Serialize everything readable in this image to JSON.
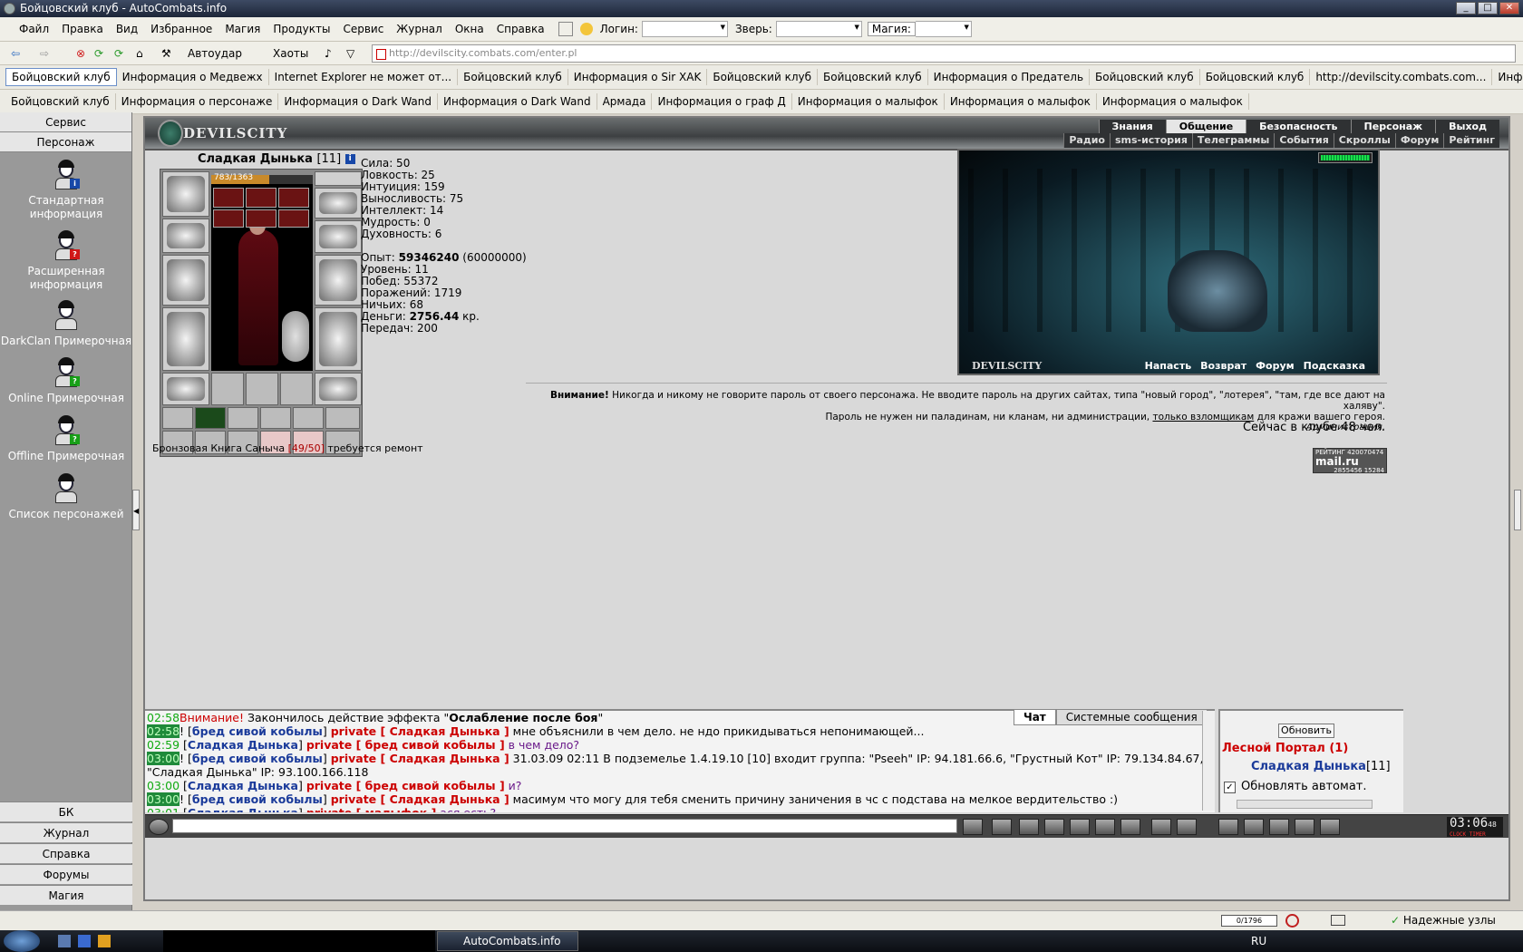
{
  "window": {
    "title": "Бойцовский клуб - AutoCombats.info"
  },
  "menu": {
    "items": [
      "Файл",
      "Правка",
      "Вид",
      "Избранное",
      "Магия",
      "Продукты",
      "Сервис",
      "Журнал",
      "Окна",
      "Справка"
    ],
    "login_label": "Логин:",
    "beast_label": "Зверь:",
    "magic_label": "Магия:"
  },
  "toolbar": {
    "autoudar": "Автоудар",
    "haoty": "Хаоты",
    "address": "http://devilscity.combats.com/enter.pl"
  },
  "tabs_row1": [
    "Бойцовский клуб",
    "Информация о Медвежх",
    "Internet Explorer не может от...",
    "Бойцовский клуб",
    "Информация о Sir XAK",
    "Бойцовский клуб",
    "Бойцовский клуб",
    "Информация о Предатель",
    "Бойцовский клуб",
    "Бойцовский клуб",
    "http://devilscity.combats.com...",
    "Информация о Сладкая Дынька"
  ],
  "tabs_row2": [
    "Бойцовский клуб",
    "Информация о персонаже",
    "Информация о Dark Wand",
    "Информация о Dark Wand",
    "Армада",
    "Информация о граф Д",
    "Информация о малыфок",
    "Информация о малыфок",
    "Информация о малыфок"
  ],
  "sidebar": {
    "top": [
      "Сервис",
      "Персонаж"
    ],
    "items": [
      {
        "label": "Стандартная информация",
        "badge": "i",
        "badge_color": "#1848a8"
      },
      {
        "label": "Расширенная информация",
        "badge": "?",
        "badge_color": "#d01818"
      },
      {
        "label": "DarkClan Примерочная",
        "badge": "",
        "badge_color": ""
      },
      {
        "label": "Online Примерочная",
        "badge": "?",
        "badge_color": "#18a018"
      },
      {
        "label": "Offline Примерочная",
        "badge": "?",
        "badge_color": "#18a018"
      },
      {
        "label": "Список персонажей",
        "badge": "",
        "badge_color": ""
      }
    ],
    "bottom": [
      "БК",
      "Журнал",
      "Справка",
      "Форумы",
      "Магия"
    ]
  },
  "game": {
    "logo": "DEVILSCITY",
    "nav1": [
      "Знания",
      "Общение",
      "Безопасность",
      "Персонаж",
      "Выход"
    ],
    "nav2": [
      "Радио",
      "sms-история",
      "Телеграммы",
      "События",
      "Скроллы",
      "Форум",
      "Рейтинг"
    ],
    "character": {
      "name": "Сладкая Дынька",
      "level": "[11]",
      "hp": "783/1363",
      "hp_fraction": 0.574
    },
    "stats": {
      "sila": "Сила: 50",
      "lovkost": "Ловкость: 25",
      "intuicia": "Интуиция: 159",
      "vynoslivost": "Выносливость: 75",
      "intellekt": "Интеллект: 14",
      "mudrost": "Мудрость: 0",
      "duhovnost": "Духовность: 6",
      "opyt_label": "Опыт:",
      "opyt_value": "59346240",
      "opyt_next": "(60000000)",
      "uroven": "Уровень: 11",
      "pobed": "Побед: 55372",
      "porazheniy": "Поражений: 1719",
      "nichyih": "Ничьих: 68",
      "dengi_label": "Деньги:",
      "dengi_value": "2756.44",
      "dengi_unit": "кр.",
      "peredach": "Передач: 200"
    },
    "book": {
      "name": "Бронзовая Книга Саныча",
      "durability": "[49/50]",
      "note": "требуется ремонт"
    },
    "scene": {
      "label": "DEVILSCITY",
      "nav": [
        "Напасть",
        "Возврат",
        "Форум",
        "Подсказка"
      ]
    },
    "warning": {
      "bold": "Внимание!",
      "line1": "Никогда и никому не говорите пароль от своего персонажа. Не вводите пароль на других сайтах, типа \"новый город\", \"лотерея\", \"там, где все дают на халяву\".",
      "line2a": "Пароль не нужен ни паладинам, ни кланам, ни администрации,",
      "line2link": "только взломщикам",
      "line2b": "для кражи вашего героя.",
      "sign": "Администрация."
    },
    "online": "Сейчас в клубе 48 чел.",
    "rating": {
      "label": "РЕЙТИНГ",
      "n1": "420070474",
      "n2": "2855456",
      "n3": "15284",
      "brand": "mail.ru"
    }
  },
  "chat": {
    "tabs": [
      "Чат",
      "Системные сообщения"
    ],
    "lines": [
      {
        "time": "02:58",
        "hl": false,
        "parts": [
          [
            "w",
            "Внимание! "
          ],
          [
            "m",
            "Закончилось действие эффекта \""
          ],
          [
            "b",
            "Ослабление после боя"
          ],
          [
            "m",
            "\""
          ]
        ]
      },
      {
        "time": "02:58",
        "hl": true,
        "parts": [
          [
            "m",
            "! ["
          ],
          [
            "n",
            "бред сивой кобылы"
          ],
          [
            "m",
            "] "
          ],
          [
            "p",
            "private [ Сладкая Дынька ]"
          ],
          [
            "m",
            " мне объяснили в чем дело. не ндо прикидываться непонимающей..."
          ]
        ]
      },
      {
        "time": "02:59",
        "hl": false,
        "parts": [
          [
            "m",
            " ["
          ],
          [
            "n",
            "Сладкая Дынька"
          ],
          [
            "m",
            "] "
          ],
          [
            "p",
            "private [ бред сивой кобылы ]"
          ],
          [
            "v",
            " в чем дело?"
          ]
        ]
      },
      {
        "time": "03:00",
        "hl": true,
        "parts": [
          [
            "m",
            "! ["
          ],
          [
            "n",
            "бред сивой кобылы"
          ],
          [
            "m",
            "] "
          ],
          [
            "p",
            "private [ Сладкая Дынька ]"
          ],
          [
            "m",
            " 31.03.09 02:11 В подземелье 1.4.19.10 [10] входит группа: \"Pseeh\" IP: 94.181.66.6, \"Грустный Кот\" IP: 79.134.84.67, \"Сладкая Дынька\" IP: 93.100.166.118"
          ]
        ]
      },
      {
        "time": "03:00",
        "hl": false,
        "parts": [
          [
            "m",
            " ["
          ],
          [
            "n",
            "Сладкая Дынька"
          ],
          [
            "m",
            "] "
          ],
          [
            "p",
            "private [ бред сивой кобылы ]"
          ],
          [
            "v",
            " и?"
          ]
        ]
      },
      {
        "time": "03:00",
        "hl": true,
        "parts": [
          [
            "m",
            "! ["
          ],
          [
            "n",
            "бред сивой кобылы"
          ],
          [
            "m",
            "] "
          ],
          [
            "p",
            "private [ Сладкая Дынька ]"
          ],
          [
            "m",
            " масимум что могу для тебя сменить причину заничения в чс с подстава на мелкое вердительство :)"
          ]
        ]
      },
      {
        "time": "03:01",
        "hl": false,
        "parts": [
          [
            "m",
            " ["
          ],
          [
            "n",
            "Сладкая Дынька"
          ],
          [
            "m",
            "] "
          ],
          [
            "p",
            "private [ малыфок ]"
          ],
          [
            "v",
            " ася есть?"
          ]
        ]
      }
    ]
  },
  "right_panel": {
    "refresh": "Обновить",
    "location": "Лесной Портал (1)",
    "player": "Сладкая Дынька",
    "player_level": "[11]",
    "auto_update": "Обновлять автомат."
  },
  "clock": {
    "time": "03:06",
    "sec": "48",
    "label": "CLOCK TIMER"
  },
  "status": {
    "counter": "0/1796",
    "zone": "Надежные узлы"
  },
  "taskbar": {
    "task": "AutoCombats.info",
    "lang": "RU"
  }
}
